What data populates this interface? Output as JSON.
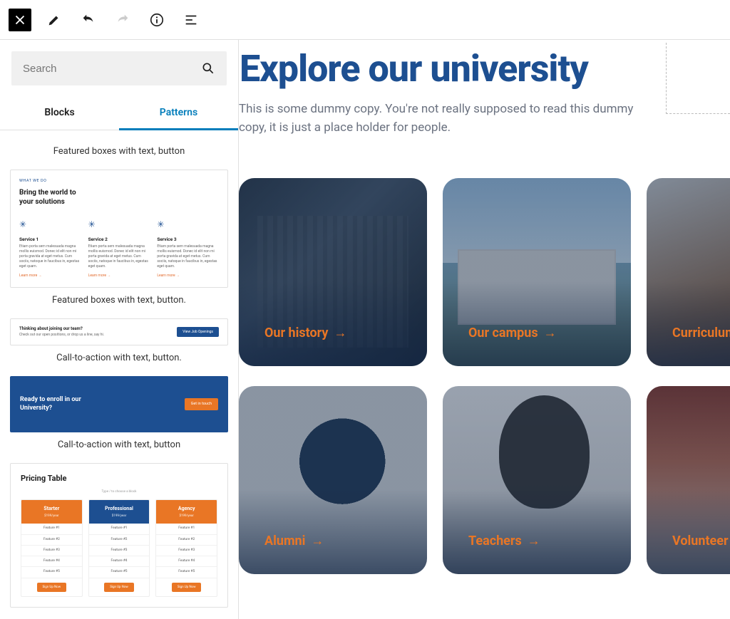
{
  "toolbar": {
    "close": "✕"
  },
  "sidebar": {
    "search": {
      "placeholder": "Search"
    },
    "tabs": {
      "blocks": "Blocks",
      "patterns": "Patterns"
    },
    "patterns": [
      {
        "caption": "Featured boxes with text, button",
        "pv1": {
          "eyebrow": "WHAT WE DO",
          "title": "Bring the world to your solutions",
          "cols": [
            {
              "h": "Service 1",
              "p": "Etiam porta sem malesuada magna mollis euismod. Donec id elit non mi porta gravida at eget metus. Cum sociis, natoque in faucibus in, egestas eget quam.",
              "link": "Learn more →"
            },
            {
              "h": "Service 2",
              "p": "Etiam porta sem malesuada magna mollis euismod. Donec id elit non mi porta gravida at eget metus. Cum sociis, natoque in faucibus in, egestas eget quam.",
              "link": "Learn more →"
            },
            {
              "h": "Service 3",
              "p": "Etiam porta sem malesuada magna mollis euismod. Donec id elit non mi porta gravida at eget metus. Cum sociis, natoque in faucibus in, egestas eget quam.",
              "link": "Learn more →"
            }
          ]
        }
      },
      {
        "caption": "Featured boxes with text, button.",
        "cta_light": {
          "title": "Thinking about joining our team?",
          "sub": "Check out our open positions, or drop us a line, say hi.",
          "button": "View Job Openings"
        }
      },
      {
        "caption": "Call-to-action with text, button.",
        "cta_dark": {
          "title": "Ready to enroll in our University?",
          "button": "Get in touch"
        }
      },
      {
        "caption": "Call-to-action with text, button",
        "pricing": {
          "title": "Pricing Table",
          "sub": "Type / to choose a block",
          "plans": [
            {
              "name": "Starter",
              "price": "$199/year",
              "head": "orange",
              "features": [
                "Feature #1",
                "Feature #2",
                "Feature #3",
                "Feature #4",
                "Feature #5"
              ],
              "button": "Sign Up Now"
            },
            {
              "name": "Professional",
              "price": "$199/year",
              "head": "navy",
              "features": [
                "Feature #1",
                "Feature #2",
                "Feature #3",
                "Feature #4",
                "Feature #5"
              ],
              "button": "Sign Up Now"
            },
            {
              "name": "Agency",
              "price": "$199/year",
              "head": "orange",
              "features": [
                "Feature #1",
                "Feature #2",
                "Feature #3",
                "Feature #4",
                "Feature #5"
              ],
              "button": "Sign Up Now"
            }
          ]
        }
      }
    ]
  },
  "main": {
    "title": "Explore our university",
    "subtitle": "This is some dummy copy. You're not really supposed to read this dummy copy, it is just a place holder for people.",
    "cards_row1": [
      {
        "label": "Our history"
      },
      {
        "label": "Our campus"
      },
      {
        "label": "Curriculum"
      }
    ],
    "cards_row2": [
      {
        "label": "Alumni"
      },
      {
        "label": "Teachers"
      },
      {
        "label": "Volunteer"
      }
    ]
  }
}
